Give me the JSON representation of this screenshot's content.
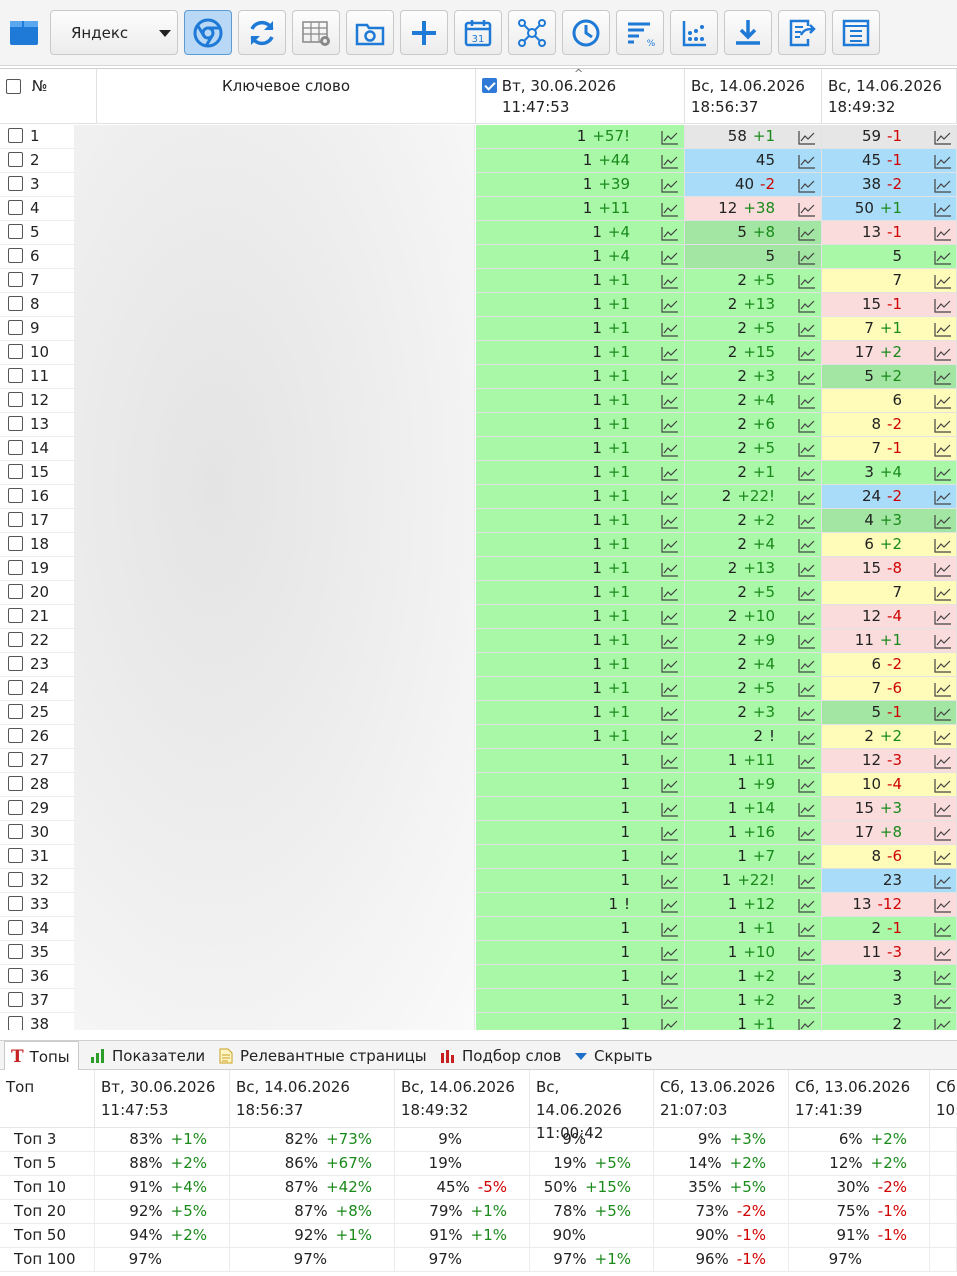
{
  "toolbar": {
    "engine": "Яндекс",
    "buttons": [
      "projects-icon",
      "chrome-icon",
      "refresh-icon",
      "table-settings-icon",
      "folder-settings-icon",
      "add-icon",
      "calendar-icon",
      "network-icon",
      "clock-icon",
      "filter-percent-icon",
      "bars-icon",
      "download-icon",
      "export-icon",
      "report-icon"
    ],
    "calendar_day": "31"
  },
  "grid": {
    "col_num": "№",
    "col_keyword": "Ключевое слово",
    "sort_indicator": "^",
    "dates": [
      {
        "day": "Вт, 30.06.2026",
        "time": "11:47:53",
        "checked": true
      },
      {
        "day": "Вс, 14.06.2026",
        "time": "18:56:37"
      },
      {
        "day": "Вс, 14.06.2026",
        "time": "18:49:32"
      }
    ],
    "colors": {
      "green": "#a8f8a8",
      "green_dark": "#a3e6a3",
      "gray": "#e6e6e6",
      "blue": "#a9dcf8",
      "pink": "#fbdcdc",
      "yellow": "#fefcb8"
    },
    "rows": [
      {
        "n": "1",
        "c": [
          [
            "1",
            "+57!",
            "green"
          ],
          [
            "58",
            "+1",
            "gray"
          ],
          [
            "59",
            "-1",
            "gray"
          ]
        ]
      },
      {
        "n": "2",
        "c": [
          [
            "1",
            "+44",
            "green"
          ],
          [
            "45",
            "",
            "blue"
          ],
          [
            "45",
            "-1",
            "blue"
          ]
        ]
      },
      {
        "n": "3",
        "c": [
          [
            "1",
            "+39",
            "green"
          ],
          [
            "40",
            "-2",
            "blue"
          ],
          [
            "38",
            "-2",
            "blue"
          ]
        ]
      },
      {
        "n": "4",
        "c": [
          [
            "1",
            "+11",
            "green"
          ],
          [
            "12",
            "+38",
            "pink"
          ],
          [
            "50",
            "+1",
            "blue"
          ]
        ]
      },
      {
        "n": "5",
        "c": [
          [
            "1",
            "+4",
            "green"
          ],
          [
            "5",
            "+8",
            "green_dark"
          ],
          [
            "13",
            "-1",
            "pink"
          ]
        ]
      },
      {
        "n": "6",
        "c": [
          [
            "1",
            "+4",
            "green"
          ],
          [
            "5",
            "",
            "green_dark"
          ],
          [
            "5",
            "",
            "green"
          ]
        ]
      },
      {
        "n": "7",
        "c": [
          [
            "1",
            "+1",
            "green"
          ],
          [
            "2",
            "+5",
            "green"
          ],
          [
            "7",
            "",
            "yellow"
          ]
        ]
      },
      {
        "n": "8",
        "c": [
          [
            "1",
            "+1",
            "green"
          ],
          [
            "2",
            "+13",
            "green"
          ],
          [
            "15",
            "-1",
            "pink"
          ]
        ]
      },
      {
        "n": "9",
        "c": [
          [
            "1",
            "+1",
            "green"
          ],
          [
            "2",
            "+5",
            "green"
          ],
          [
            "7",
            "+1",
            "yellow"
          ]
        ]
      },
      {
        "n": "10",
        "c": [
          [
            "1",
            "+1",
            "green"
          ],
          [
            "2",
            "+15",
            "green"
          ],
          [
            "17",
            "+2",
            "pink"
          ]
        ]
      },
      {
        "n": "11",
        "c": [
          [
            "1",
            "+1",
            "green"
          ],
          [
            "2",
            "+3",
            "green"
          ],
          [
            "5",
            "+2",
            "green_dark"
          ]
        ]
      },
      {
        "n": "12",
        "c": [
          [
            "1",
            "+1",
            "green"
          ],
          [
            "2",
            "+4",
            "green"
          ],
          [
            "6",
            "",
            "yellow"
          ]
        ]
      },
      {
        "n": "13",
        "c": [
          [
            "1",
            "+1",
            "green"
          ],
          [
            "2",
            "+6",
            "green"
          ],
          [
            "8",
            "-2",
            "yellow"
          ]
        ]
      },
      {
        "n": "14",
        "c": [
          [
            "1",
            "+1",
            "green"
          ],
          [
            "2",
            "+5",
            "green"
          ],
          [
            "7",
            "-1",
            "yellow"
          ]
        ]
      },
      {
        "n": "15",
        "c": [
          [
            "1",
            "+1",
            "green"
          ],
          [
            "2",
            "+1",
            "green"
          ],
          [
            "3",
            "+4",
            "green"
          ]
        ]
      },
      {
        "n": "16",
        "c": [
          [
            "1",
            "+1",
            "green"
          ],
          [
            "2",
            "+22!",
            "green"
          ],
          [
            "24",
            "-2",
            "blue"
          ]
        ]
      },
      {
        "n": "17",
        "c": [
          [
            "1",
            "+1",
            "green"
          ],
          [
            "2",
            "+2",
            "green"
          ],
          [
            "4",
            "+3",
            "green_dark"
          ]
        ]
      },
      {
        "n": "18",
        "c": [
          [
            "1",
            "+1",
            "green"
          ],
          [
            "2",
            "+4",
            "green"
          ],
          [
            "6",
            "+2",
            "yellow"
          ]
        ]
      },
      {
        "n": "19",
        "c": [
          [
            "1",
            "+1",
            "green"
          ],
          [
            "2",
            "+13",
            "green"
          ],
          [
            "15",
            "-8",
            "pink"
          ]
        ]
      },
      {
        "n": "20",
        "c": [
          [
            "1",
            "+1",
            "green"
          ],
          [
            "2",
            "+5",
            "green"
          ],
          [
            "7",
            "",
            "yellow"
          ]
        ]
      },
      {
        "n": "21",
        "c": [
          [
            "1",
            "+1",
            "green"
          ],
          [
            "2",
            "+10",
            "green"
          ],
          [
            "12",
            "-4",
            "pink"
          ]
        ]
      },
      {
        "n": "22",
        "c": [
          [
            "1",
            "+1",
            "green"
          ],
          [
            "2",
            "+9",
            "green"
          ],
          [
            "11",
            "+1",
            "pink"
          ]
        ]
      },
      {
        "n": "23",
        "c": [
          [
            "1",
            "+1",
            "green"
          ],
          [
            "2",
            "+4",
            "green"
          ],
          [
            "6",
            "-2",
            "yellow"
          ]
        ]
      },
      {
        "n": "24",
        "c": [
          [
            "1",
            "+1",
            "green"
          ],
          [
            "2",
            "+5",
            "green"
          ],
          [
            "7",
            "-6",
            "yellow"
          ]
        ]
      },
      {
        "n": "25",
        "c": [
          [
            "1",
            "+1",
            "green"
          ],
          [
            "2",
            "+3",
            "green"
          ],
          [
            "5",
            "-1",
            "green_dark"
          ]
        ]
      },
      {
        "n": "26",
        "c": [
          [
            "1",
            "+1",
            "green"
          ],
          [
            "2",
            "!",
            "green"
          ],
          [
            "2",
            "+2",
            "yellow"
          ]
        ]
      },
      {
        "n": "27",
        "c": [
          [
            "1",
            "",
            "green"
          ],
          [
            "1",
            "+11",
            "green"
          ],
          [
            "12",
            "-3",
            "pink"
          ]
        ]
      },
      {
        "n": "28",
        "c": [
          [
            "1",
            "",
            "green"
          ],
          [
            "1",
            "+9",
            "green"
          ],
          [
            "10",
            "-4",
            "yellow"
          ]
        ]
      },
      {
        "n": "29",
        "c": [
          [
            "1",
            "",
            "green"
          ],
          [
            "1",
            "+14",
            "green"
          ],
          [
            "15",
            "+3",
            "pink"
          ]
        ]
      },
      {
        "n": "30",
        "c": [
          [
            "1",
            "",
            "green"
          ],
          [
            "1",
            "+16",
            "green"
          ],
          [
            "17",
            "+8",
            "pink"
          ]
        ]
      },
      {
        "n": "31",
        "c": [
          [
            "1",
            "",
            "green"
          ],
          [
            "1",
            "+7",
            "green"
          ],
          [
            "8",
            "-6",
            "yellow"
          ]
        ]
      },
      {
        "n": "32",
        "c": [
          [
            "1",
            "",
            "green"
          ],
          [
            "1",
            "+22!",
            "green"
          ],
          [
            "23",
            "",
            "blue"
          ]
        ]
      },
      {
        "n": "33",
        "c": [
          [
            "1",
            "!",
            "green"
          ],
          [
            "1",
            "+12",
            "green"
          ],
          [
            "13",
            "-12",
            "pink"
          ]
        ]
      },
      {
        "n": "34",
        "c": [
          [
            "1",
            "",
            "green"
          ],
          [
            "1",
            "+1",
            "green"
          ],
          [
            "2",
            "-1",
            "green"
          ]
        ]
      },
      {
        "n": "35",
        "c": [
          [
            "1",
            "",
            "green"
          ],
          [
            "1",
            "+10",
            "green"
          ],
          [
            "11",
            "-3",
            "pink"
          ]
        ]
      },
      {
        "n": "36",
        "c": [
          [
            "1",
            "",
            "green"
          ],
          [
            "1",
            "+2",
            "green"
          ],
          [
            "3",
            "",
            "green"
          ]
        ]
      },
      {
        "n": "37",
        "c": [
          [
            "1",
            "",
            "green"
          ],
          [
            "1",
            "+2",
            "green"
          ],
          [
            "3",
            "",
            "green"
          ]
        ]
      },
      {
        "n": "38",
        "c": [
          [
            "1",
            "",
            "green"
          ],
          [
            "1",
            "+1",
            "green"
          ],
          [
            "2",
            "",
            "green"
          ]
        ]
      }
    ]
  },
  "tabs": [
    {
      "label": "Топы",
      "icon": "top-icon",
      "selected": true
    },
    {
      "label": "Показатели",
      "icon": "chart-icon"
    },
    {
      "label": "Релевантные страницы",
      "icon": "page-icon"
    },
    {
      "label": "Подбор слов",
      "icon": "words-icon"
    },
    {
      "label": "Скрыть",
      "icon": "hide-icon"
    }
  ],
  "stats": {
    "col_top": "Топ",
    "dates": [
      {
        "day": "Вт, 30.06.2026",
        "time": "11:47:53"
      },
      {
        "day": "Вс, 14.06.2026",
        "time": "18:56:37"
      },
      {
        "day": "Вс, 14.06.2026",
        "time": "18:49:32"
      },
      {
        "day": "Вс, 14.06.2026",
        "time": "11:00:42"
      },
      {
        "day": "Сб, 13.06.2026",
        "time": "21:07:03"
      },
      {
        "day": "Сб, 13.06.2026",
        "time": "17:41:39"
      },
      {
        "day": "Сб",
        "time": "10:"
      }
    ],
    "rows": [
      {
        "label": "Топ 3",
        "c": [
          [
            "83%",
            "+1%"
          ],
          [
            "82%",
            "+73%"
          ],
          [
            "9%",
            ""
          ],
          [
            "9%",
            ""
          ],
          [
            "9%",
            "+3%"
          ],
          [
            "6%",
            "+2%"
          ]
        ]
      },
      {
        "label": "Топ 5",
        "c": [
          [
            "88%",
            "+2%"
          ],
          [
            "86%",
            "+67%"
          ],
          [
            "19%",
            ""
          ],
          [
            "19%",
            "+5%"
          ],
          [
            "14%",
            "+2%"
          ],
          [
            "12%",
            "+2%"
          ]
        ]
      },
      {
        "label": "Топ 10",
        "c": [
          [
            "91%",
            "+4%"
          ],
          [
            "87%",
            "+42%"
          ],
          [
            "45%",
            "-5%"
          ],
          [
            "50%",
            "+15%"
          ],
          [
            "35%",
            "+5%"
          ],
          [
            "30%",
            "-2%"
          ]
        ]
      },
      {
        "label": "Топ 20",
        "c": [
          [
            "92%",
            "+5%"
          ],
          [
            "87%",
            "+8%"
          ],
          [
            "79%",
            "+1%"
          ],
          [
            "78%",
            "+5%"
          ],
          [
            "73%",
            "-2%"
          ],
          [
            "75%",
            "-1%"
          ]
        ]
      },
      {
        "label": "Топ 50",
        "c": [
          [
            "94%",
            "+2%"
          ],
          [
            "92%",
            "+1%"
          ],
          [
            "91%",
            "+1%"
          ],
          [
            "90%",
            ""
          ],
          [
            "90%",
            "-1%"
          ],
          [
            "91%",
            "-1%"
          ]
        ]
      },
      {
        "label": "Топ 100",
        "c": [
          [
            "97%",
            ""
          ],
          [
            "97%",
            ""
          ],
          [
            "97%",
            ""
          ],
          [
            "97%",
            "+1%"
          ],
          [
            "96%",
            "-1%"
          ],
          [
            "97%",
            ""
          ]
        ]
      }
    ]
  }
}
